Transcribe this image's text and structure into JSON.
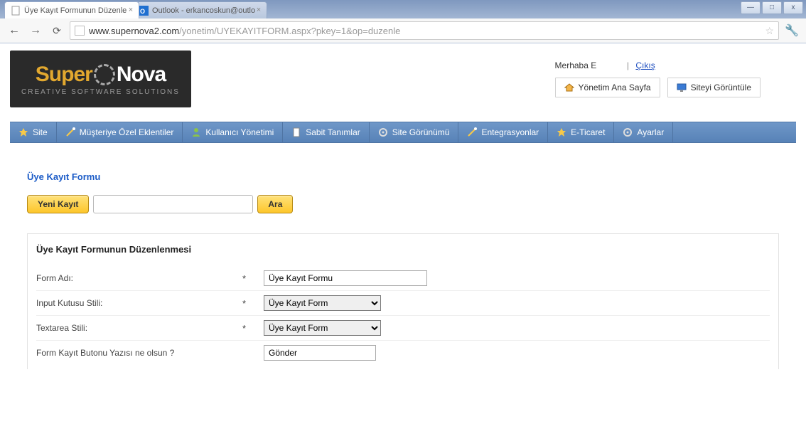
{
  "browser": {
    "tabs": [
      {
        "title": "Üye Kayıt Formunun Düzenle",
        "active": true
      },
      {
        "title": "Outlook - erkancoskun@outlo",
        "active": false
      }
    ],
    "url_host": "www.supernova2.com",
    "url_path": "/yonetim/UYEKAYITFORM.aspx?pkey=1&op=duzenle",
    "win_min": "—",
    "win_max": "□",
    "win_close": "x"
  },
  "logo": {
    "part1": "Super",
    "part2": "Nova",
    "tagline": "CREATIVE SOFTWARE SOLUTIONS"
  },
  "header": {
    "greeting": "Merhaba E",
    "logout": "Çıkış",
    "btn_admin_home": "Yönetim Ana Sayfa",
    "btn_view_site": "Siteyi Görüntüle"
  },
  "menu": {
    "items": [
      "Site",
      "Müşteriye Özel Eklentiler",
      "Kullanıcı Yönetimi",
      "Sabit Tanımlar",
      "Site Görünümü",
      "Entegrasyonlar",
      "E-Ticaret",
      "Ayarlar"
    ]
  },
  "section": {
    "title": "Üye Kayıt Formu",
    "new_record": "Yeni Kayıt",
    "search_btn": "Ara"
  },
  "panel": {
    "title": "Üye Kayıt Formunun Düzenlenmesi",
    "rows": {
      "form_adi_label": "Form Adı:",
      "form_adi_value": "Üye Kayıt Formu",
      "input_stili_label": "Input Kutusu Stili:",
      "input_stili_value": "Üye Kayıt Form",
      "textarea_stili_label": "Textarea Stili:",
      "textarea_stili_value": "Üye Kayıt Form",
      "buton_yazisi_label": "Form Kayıt Butonu Yazısı ne olsun ?",
      "buton_yazisi_value": "Gönder"
    }
  }
}
